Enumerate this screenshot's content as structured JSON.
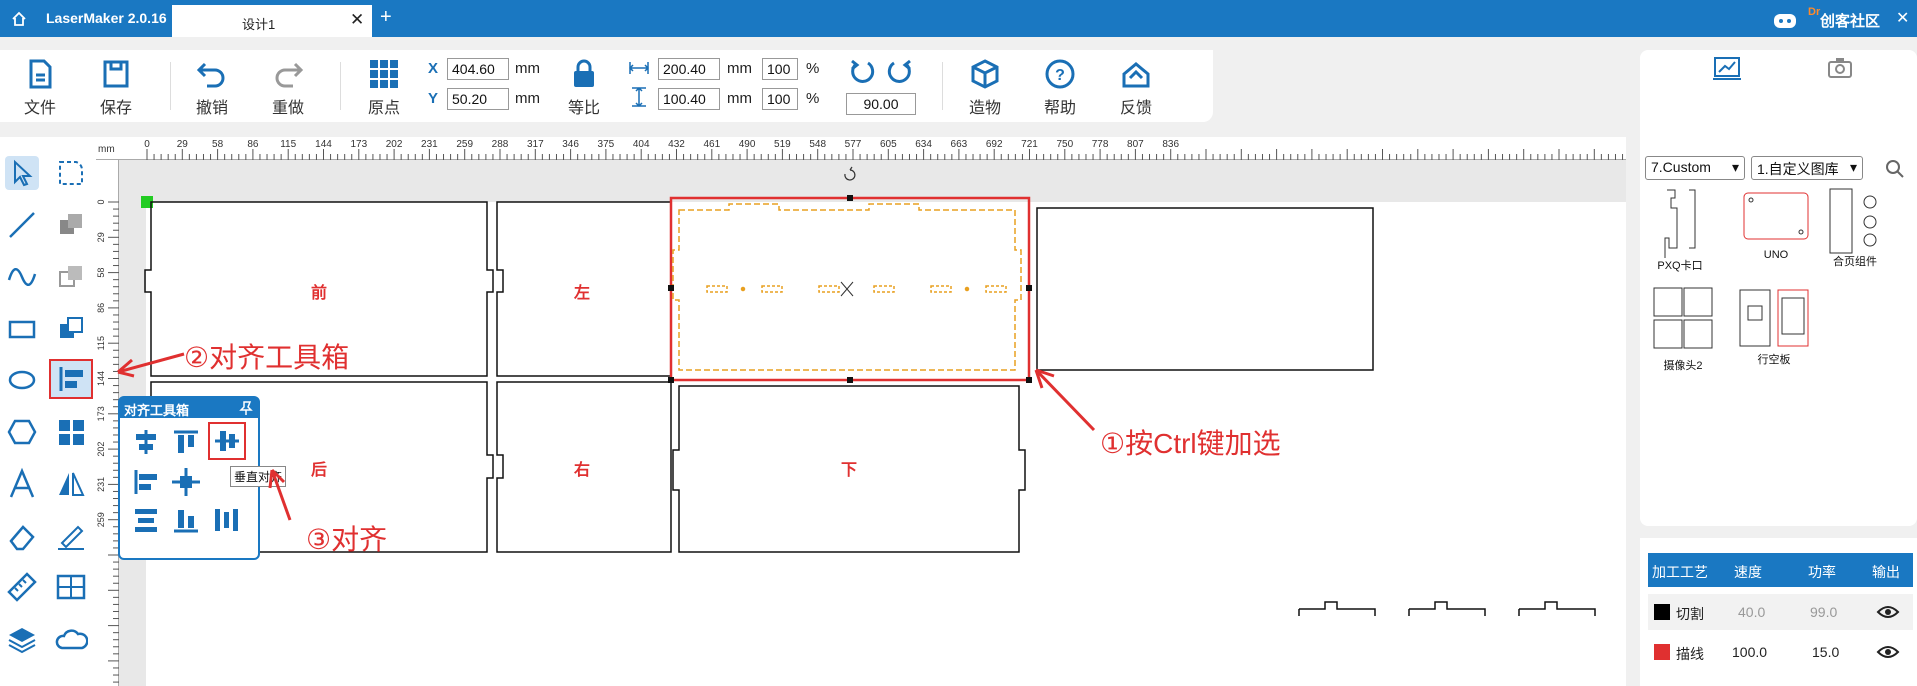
{
  "titlebar": {
    "app_name": "LaserMaker 2.0.16",
    "tab_label": "设计1",
    "tab_close": "✕",
    "new_tab": "+",
    "brand": "创客社区",
    "close": "✕",
    "brand_prefix": "Dr"
  },
  "toolbar": {
    "file": "文件",
    "save": "保存",
    "undo": "撤销",
    "redo": "重做",
    "origin": "原点",
    "x_label": "X",
    "x_value": "404.60",
    "y_label": "Y",
    "y_value": "50.20",
    "unit": "mm",
    "lock_label": "等比",
    "width_value": "200.40",
    "height_value": "100.40",
    "width_pct": "100",
    "height_pct": "100",
    "pct": "%",
    "rotation_value": "90.00",
    "build": "造物",
    "help": "帮助",
    "feedback": "反馈"
  },
  "right_panel": {
    "dropdown1": "7.Custom",
    "dropdown2": "1.自定义图库",
    "items": [
      {
        "label": "PXQ卡口"
      },
      {
        "label": "UNO"
      },
      {
        "label": "合页组件"
      },
      {
        "label": "摄像头2"
      },
      {
        "label": "行空板"
      }
    ]
  },
  "process": {
    "headers": [
      "加工工艺",
      "速度",
      "功率",
      "输出"
    ],
    "rows": [
      {
        "name": "切割",
        "speed": "40.0",
        "power": "99.0",
        "color": "#000000"
      },
      {
        "name": "描线",
        "speed": "100.0",
        "power": "15.0",
        "color": "#e03030"
      }
    ]
  },
  "ruler": {
    "unit": "mm",
    "h_ticks": [
      "0",
      "29",
      "58",
      "86",
      "115",
      "144",
      "173",
      "202",
      "231",
      "259",
      "288",
      "317",
      "346",
      "375",
      "404",
      "432",
      "461",
      "490",
      "519",
      "548",
      "577",
      "605",
      "634",
      "663",
      "692",
      "721",
      "750",
      "778",
      "807",
      "836"
    ],
    "v_ticks": [
      "0",
      "29",
      "58",
      "86",
      "115",
      "144",
      "173",
      "202",
      "231",
      "259"
    ]
  },
  "canvas": {
    "panels": [
      "前",
      "左",
      "后",
      "右",
      "下"
    ]
  },
  "align_box": {
    "title": "对齐工具箱",
    "tooltip": "垂直对齐"
  },
  "annotations": {
    "a1": "①按Ctrl键加选",
    "a2": "②对齐工具箱",
    "a3": "③对齐"
  },
  "colors": {
    "accent": "#1a78c2",
    "annotation": "#e03030",
    "selection": "#e8a020"
  }
}
